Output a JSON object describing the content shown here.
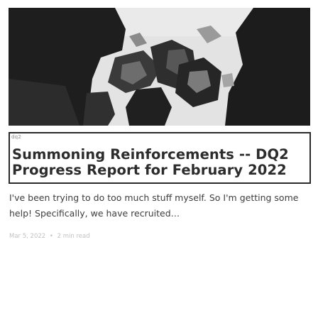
{
  "post": {
    "tag": "dq2",
    "title": "Summoning Reinforcements -- DQ2 Progress Report for February 2022",
    "excerpt": "I've been trying to do too much stuff myself. So I'm getting some help! Specifically, we have recruited…",
    "date": "Mar 5, 2022",
    "separator": "•",
    "read_time": "2 min read"
  },
  "cover_image": {
    "description_icon": "robot-army-image"
  }
}
